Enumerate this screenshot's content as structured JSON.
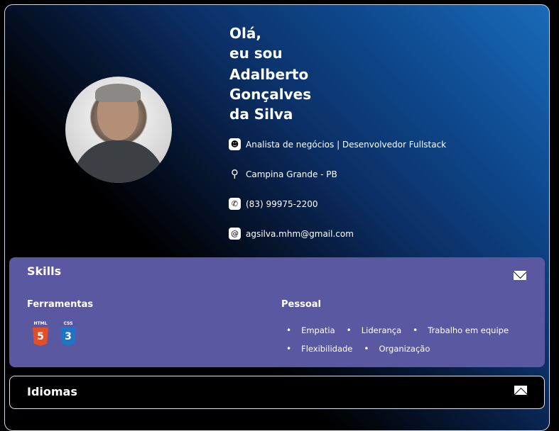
{
  "hero": {
    "greeting_line1": "Olá,",
    "greeting_line2": "eu sou",
    "name_line1": "Adalberto",
    "name_line2": "Gonçalves",
    "name_line3": "da Silva"
  },
  "info": {
    "role": "Analista de negócios | Desenvolvedor Fullstack",
    "location": "Campina Grande - PB",
    "phone": "(83) 99975-2200",
    "email": "agsilva.mhm@gmail.com",
    "icons": [
      "user-icon",
      "location-pin-icon",
      "whatsapp-icon",
      "at-icon"
    ]
  },
  "skills": {
    "title": "Skills",
    "tools_label": "Ferramentas",
    "tools": [
      {
        "caption": "HTML",
        "number": "5"
      },
      {
        "caption": "CSS",
        "number": "3"
      }
    ],
    "personal_label": "Pessoal",
    "personal_row1": [
      "Empatia",
      "Liderança",
      "Trabalho em equipe"
    ],
    "personal_row2": [
      "Flexibilidade",
      "Organização"
    ]
  },
  "languages": {
    "title": "Idiomas"
  },
  "colors": {
    "skills_bg": "#5a58a0",
    "html_badge": "#e44d26",
    "css_badge": "#1f74c4",
    "gradient_blue": "#1a6ab8"
  }
}
